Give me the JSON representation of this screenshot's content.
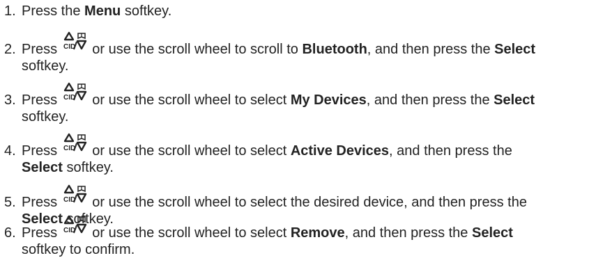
{
  "steps": [
    {
      "num": "1.",
      "t1": "Press the ",
      "b1": "Menu",
      "t2": " softkey."
    },
    {
      "num": "2.",
      "t1": "Press ",
      "t2": " or use the scroll wheel to scroll to ",
      "b1": "Bluetooth",
      "t3": ", and then press the ",
      "b2": "Select",
      "t4": "softkey."
    },
    {
      "num": "3.",
      "t1": "Press ",
      "t2": " or use the scroll wheel to select ",
      "b1": "My Devices",
      "t3": ", and then press the ",
      "b2": "Select",
      "t4": "softkey."
    },
    {
      "num": "4.",
      "t1": "Press ",
      "t2": " or use the scroll wheel to select ",
      "b1": "Active Devices",
      "t3": ", and then press the",
      "b2": "Select",
      "t4": " softkey."
    },
    {
      "num": "5.",
      "t1": "Press ",
      "t2": " or use the scroll wheel to select the desired device, and then press the",
      "b2": "Select",
      "t4": " softkey."
    },
    {
      "num": "6.",
      "t1": "Press ",
      "t2": " or use the scroll wheel to select ",
      "b1": "Remove",
      "t3": ", and then press the ",
      "b2": "Select",
      "t4": "softkey to confirm."
    }
  ],
  "key_icon": {
    "name": "cid-up-phonebook-down-key-icon",
    "label": "CID"
  }
}
